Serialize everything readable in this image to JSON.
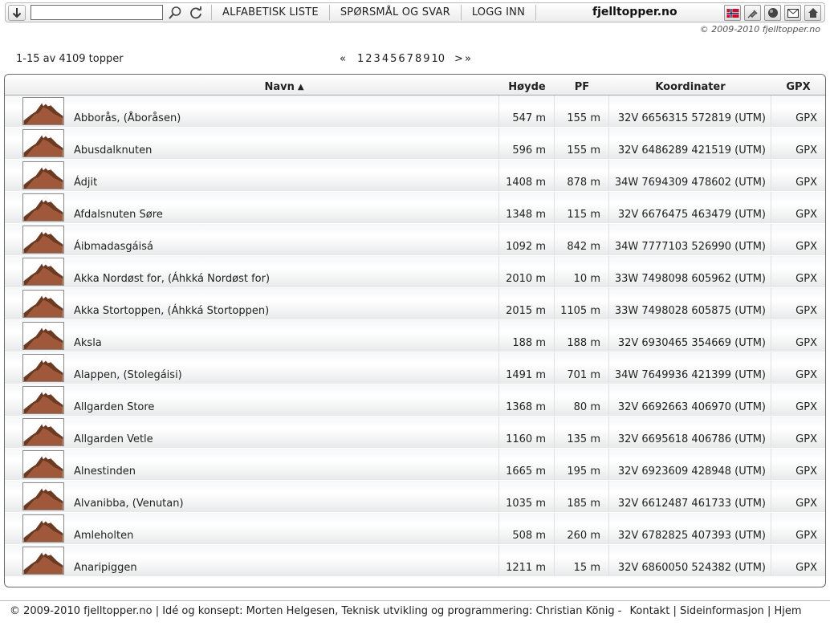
{
  "topbar": {
    "search_placeholder": "",
    "menu": [
      "ALFABETISK LISTE",
      "SPØRSMÅL OG SVAR",
      "LOGG INN"
    ],
    "site_title": "fjelltopper.no",
    "icons_right": [
      "norway-flag-icon",
      "pin-icon",
      "globe-icon",
      "mail-icon",
      "home-icon"
    ]
  },
  "copyright": "© 2009-2010 fjelltopper.no",
  "results": {
    "count_label": "1-15 av 4109 topper",
    "pager_first": "«",
    "pages": [
      "1",
      "2",
      "3",
      "4",
      "5",
      "6",
      "7",
      "8",
      "9",
      "10"
    ],
    "current_page": "1",
    "pager_next": ">",
    "pager_last": "»"
  },
  "table": {
    "headers": {
      "name": "Navn",
      "height": "Høyde",
      "pf": "PF",
      "coords": "Koordinater",
      "gpx": "GPX"
    },
    "rows": [
      {
        "name": "Abborås, (Åboråsen)",
        "height": "547 m",
        "pf": "155 m",
        "coords": "32V 6656315 572819 (UTM)",
        "gpx": "GPX"
      },
      {
        "name": "Abusdalknuten",
        "height": "596 m",
        "pf": "155 m",
        "coords": "32V 6486289 421519 (UTM)",
        "gpx": "GPX"
      },
      {
        "name": "Ádjit",
        "height": "1408 m",
        "pf": "878 m",
        "coords": "34W 7694309 478602 (UTM)",
        "gpx": "GPX"
      },
      {
        "name": "Afdalsnuten Søre",
        "height": "1348 m",
        "pf": "115 m",
        "coords": "32V 6676475 463479 (UTM)",
        "gpx": "GPX"
      },
      {
        "name": "Áibmadasgáisá",
        "height": "1092 m",
        "pf": "842 m",
        "coords": "34W 7777103 526990 (UTM)",
        "gpx": "GPX"
      },
      {
        "name": "Akka Nordøst for, (Áhkká Nordøst for)",
        "height": "2010 m",
        "pf": "10 m",
        "coords": "33W 7498098 605962 (UTM)",
        "gpx": "GPX"
      },
      {
        "name": "Akka Stortoppen, (Áhkká Stortoppen)",
        "height": "2015 m",
        "pf": "1105 m",
        "coords": "33W 7498028 605875 (UTM)",
        "gpx": "GPX"
      },
      {
        "name": "Aksla",
        "height": "188 m",
        "pf": "188 m",
        "coords": "32V 6930465 354669 (UTM)",
        "gpx": "GPX"
      },
      {
        "name": "Alappen, (Stolegáisi)",
        "height": "1491 m",
        "pf": "701 m",
        "coords": "34W 7649936 421399 (UTM)",
        "gpx": "GPX"
      },
      {
        "name": "Allgarden Store",
        "height": "1368 m",
        "pf": "80 m",
        "coords": "32V 6692663 406970 (UTM)",
        "gpx": "GPX"
      },
      {
        "name": "Allgarden Vetle",
        "height": "1160 m",
        "pf": "135 m",
        "coords": "32V 6695618 406786 (UTM)",
        "gpx": "GPX"
      },
      {
        "name": "Alnestinden",
        "height": "1665 m",
        "pf": "195 m",
        "coords": "32V 6923609 428948 (UTM)",
        "gpx": "GPX"
      },
      {
        "name": "Alvanibba, (Venutan)",
        "height": "1035 m",
        "pf": "185 m",
        "coords": "32V 6612487 461733 (UTM)",
        "gpx": "GPX"
      },
      {
        "name": "Amleholten",
        "height": "508 m",
        "pf": "260 m",
        "coords": "32V 6782825 407393 (UTM)",
        "gpx": "GPX"
      },
      {
        "name": "Anaripiggen",
        "height": "1211 m",
        "pf": "15 m",
        "coords": "32V 6860050 524382 (UTM)",
        "gpx": "GPX"
      }
    ]
  },
  "footer": {
    "text": "© 2009-2010 fjelltopper.no | Idé og konsept: Morten Helgesen, Teknisk utvikling og programmering: Christian König -",
    "links": [
      "Kontakt",
      "Sideinformasjon",
      "Hjem"
    ]
  }
}
